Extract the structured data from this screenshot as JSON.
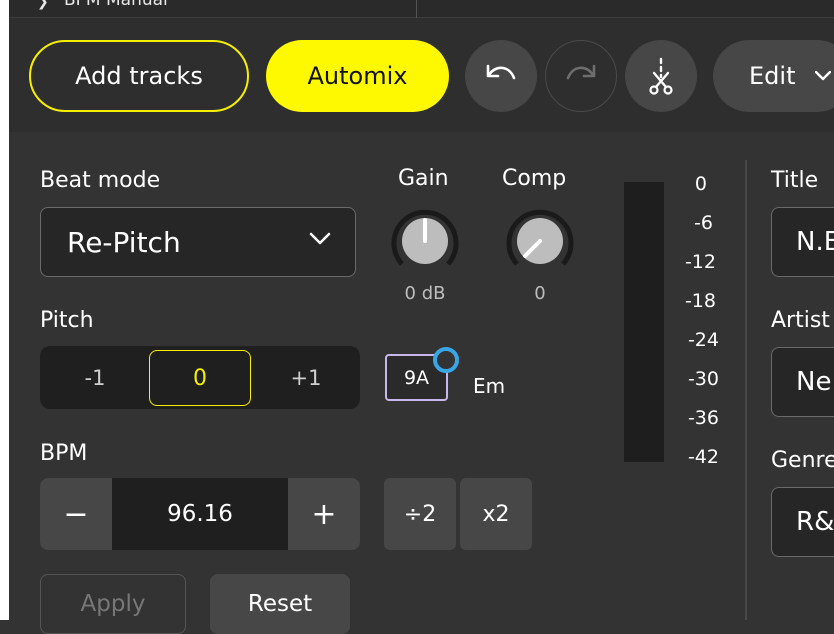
{
  "header": {
    "tab_label": "BPM Manual"
  },
  "toolbar": {
    "add_tracks": "Add tracks",
    "automix": "Automix",
    "edit": "Edit",
    "undo_icon": "undo-icon",
    "redo_icon": "redo-icon",
    "cut_icon": "scissors-icon",
    "accent": "#fff900"
  },
  "beat_mode": {
    "label": "Beat mode",
    "value": "Re-Pitch"
  },
  "gain": {
    "label": "Gain",
    "value": "0 dB"
  },
  "comp": {
    "label": "Comp",
    "value": "0"
  },
  "pitch": {
    "label": "Pitch",
    "options": [
      "-1",
      "0",
      "+1"
    ],
    "selected": "0"
  },
  "key": {
    "camelot": "9A",
    "name": "Em",
    "indicator_color": "#39a6e6"
  },
  "bpm": {
    "label": "BPM",
    "value": "96.16",
    "minus": "−",
    "plus": "+",
    "half": "÷2",
    "double": "x2"
  },
  "actions": {
    "apply": "Apply",
    "reset": "Reset"
  },
  "meter": {
    "scale": [
      "0",
      "-6",
      "-12",
      "-18",
      "-24",
      "-30",
      "-36",
      "-42"
    ]
  },
  "metadata": {
    "title_label": "Title",
    "title_value": "N.E",
    "artist_label": "Artist",
    "artist_value": "Ne",
    "genre_label": "Genre",
    "genre_value": "R&"
  }
}
